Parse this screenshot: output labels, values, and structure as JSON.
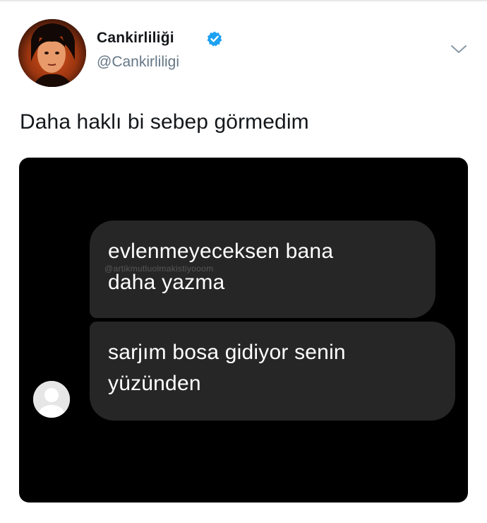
{
  "tweet": {
    "display_name": "Cankirliliği",
    "handle": "@Cankirliligi",
    "text": "Daha haklı bi sebep görmedim",
    "verified": true
  },
  "screenshot": {
    "messages": [
      {
        "lines": [
          "evlenmeyeceksen bana",
          "daha yazma"
        ]
      },
      {
        "lines": [
          "sarjım bosa gidiyor senin",
          "yüzünden"
        ]
      }
    ],
    "watermark": "@artikmutluolmakistiyooom"
  },
  "icons": {
    "verified": "verified-badge-icon",
    "menu": "chevron-down-icon",
    "sender": "default-avatar-icon"
  },
  "colors": {
    "verified_blue": "#1da1f2",
    "handle_gray": "#657786",
    "bubble_gray": "#262626"
  }
}
